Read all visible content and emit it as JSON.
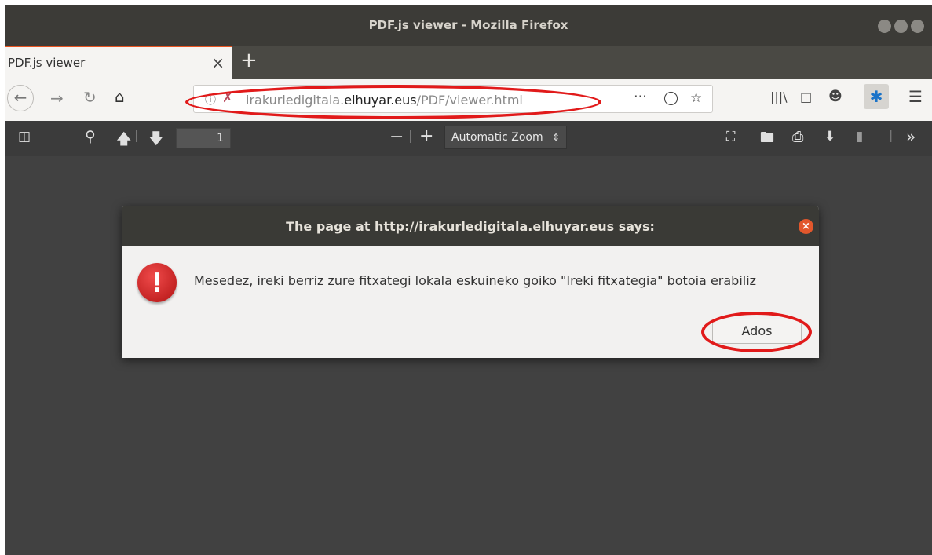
{
  "window": {
    "title": "PDF.js viewer - Mozilla Firefox"
  },
  "tab": {
    "label": "PDF.js viewer",
    "close_label": "×",
    "new_tab_label": "+"
  },
  "urlbar": {
    "url_domain_prefix": "irakurledigitala.",
    "url_domain": "elhuyar.eus",
    "url_path": "/PDF/viewer.html"
  },
  "pdf_toolbar": {
    "page_number": "1",
    "zoom_label": "Automatic Zoom"
  },
  "dialog": {
    "title": "The page at http://irakurledigitala.elhuyar.eus says:",
    "message": "Mesedez, ireki berriz zure fitxategi lokala eskuineko goiko \"Ireki fitxategia\" botoia erabiliz",
    "ok_label": "Ados",
    "close_label": "×"
  },
  "colors": {
    "annotation": "#e11a1a",
    "accent": "#e95420",
    "viewer_bg": "#414141"
  }
}
